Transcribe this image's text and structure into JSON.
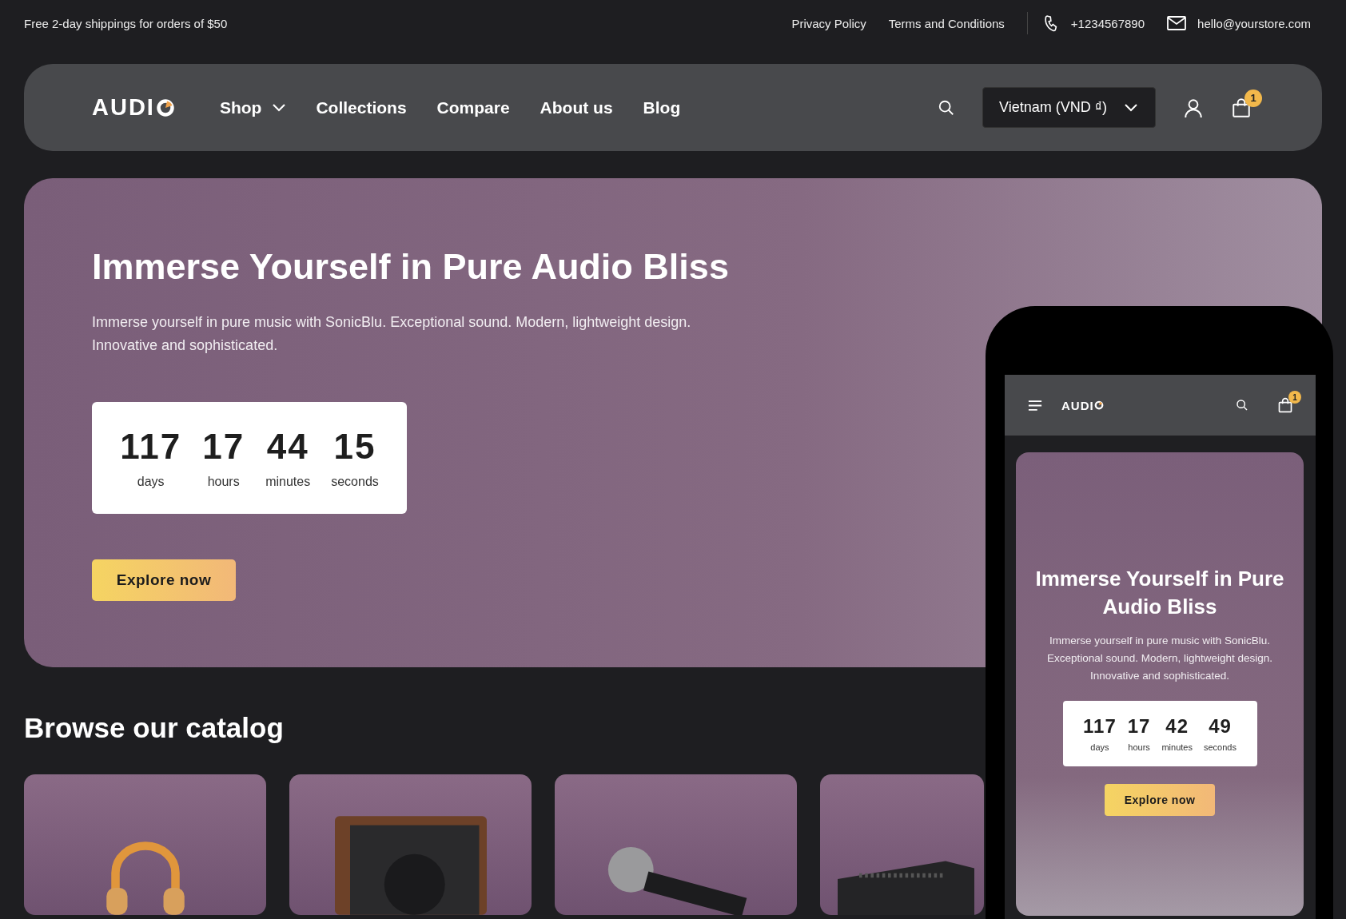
{
  "top_bar": {
    "promo": "Free 2-day shippings for orders of $50",
    "links": [
      "Privacy Policy",
      "Terms and Conditions"
    ],
    "phone": "+1234567890",
    "email": "hello@yourstore.com"
  },
  "nav": {
    "logo": "AUDI",
    "items": [
      {
        "label": "Shop",
        "has_dropdown": true
      },
      {
        "label": "Collections",
        "has_dropdown": false
      },
      {
        "label": "Compare",
        "has_dropdown": false
      },
      {
        "label": "About us",
        "has_dropdown": false
      },
      {
        "label": "Blog",
        "has_dropdown": false
      }
    ],
    "currency": "Vietnam (VND ₫)",
    "cart_count": "1"
  },
  "hero": {
    "title": "Immerse Yourself in Pure Audio Bliss",
    "description": "Immerse yourself in pure music with SonicBlu. Exceptional sound. Modern, lightweight design. Innovative and sophisticated.",
    "countdown": [
      {
        "value": "117",
        "unit": "days"
      },
      {
        "value": "17",
        "unit": "hours"
      },
      {
        "value": "44",
        "unit": "minutes"
      },
      {
        "value": "15",
        "unit": "seconds"
      }
    ],
    "button": "Explore now"
  },
  "catalog": {
    "title": "Browse our catalog",
    "products": [
      {
        "kind": "headphones"
      },
      {
        "kind": "speaker"
      },
      {
        "kind": "microphone"
      },
      {
        "kind": "amplifier"
      }
    ]
  },
  "phone_preview": {
    "logo": "AUDI",
    "cart_count": "1",
    "hero": {
      "title": "Immerse Yourself in Pure Audio Bliss",
      "description": "Immerse yourself in pure music with SonicBlu. Exceptional sound. Modern, lightweight design. Innovative and sophisticated.",
      "countdown": [
        {
          "value": "117",
          "unit": "days"
        },
        {
          "value": "17",
          "unit": "hours"
        },
        {
          "value": "42",
          "unit": "minutes"
        },
        {
          "value": "49",
          "unit": "seconds"
        }
      ],
      "button": "Explore now"
    }
  }
}
